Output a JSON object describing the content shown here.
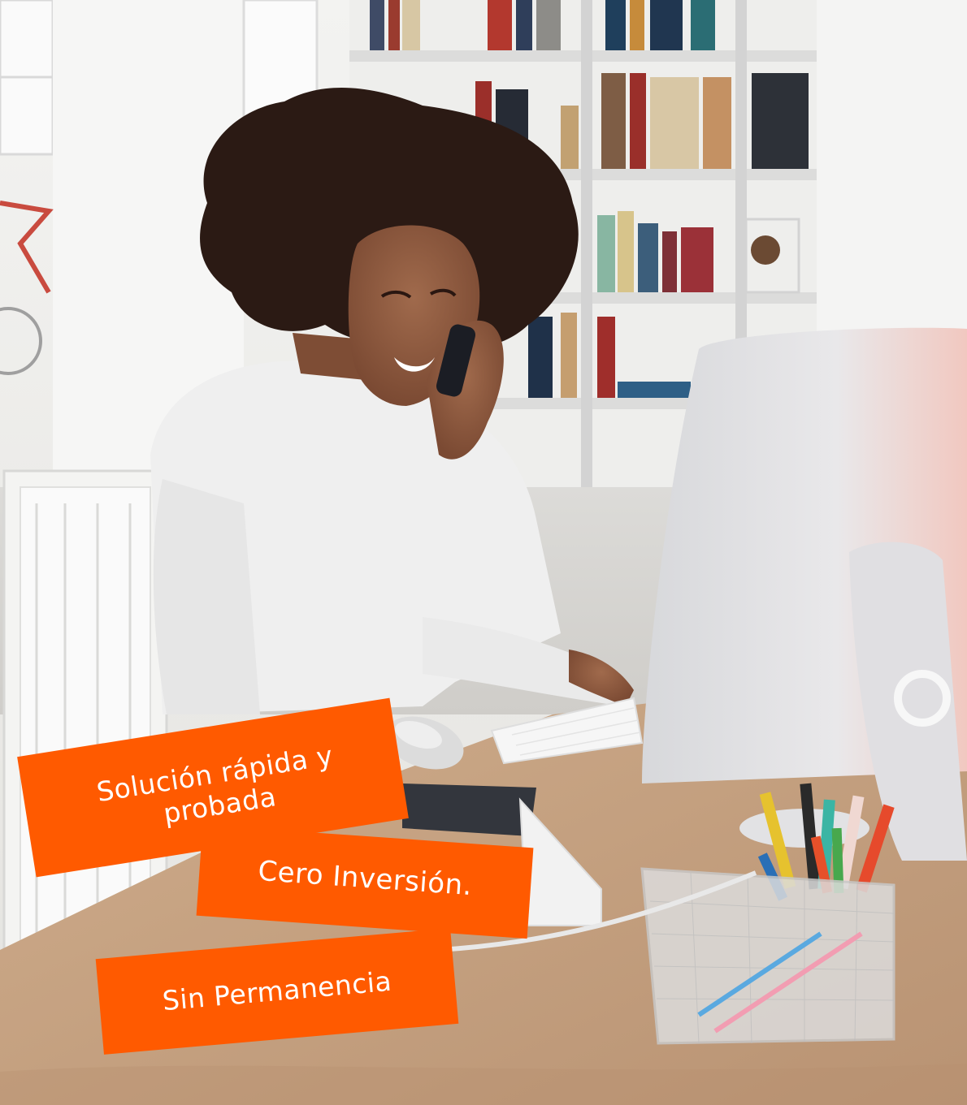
{
  "photo": {
    "subject_icon": "woman-on-phone-at-computer-illustration"
  },
  "labels": {
    "tag1": "Solución rápida y probada",
    "tag2": "Cero Inversión.",
    "tag3": "Sin Permanencia"
  },
  "colors": {
    "accent": "#ff5a00",
    "text": "#ffffff"
  }
}
